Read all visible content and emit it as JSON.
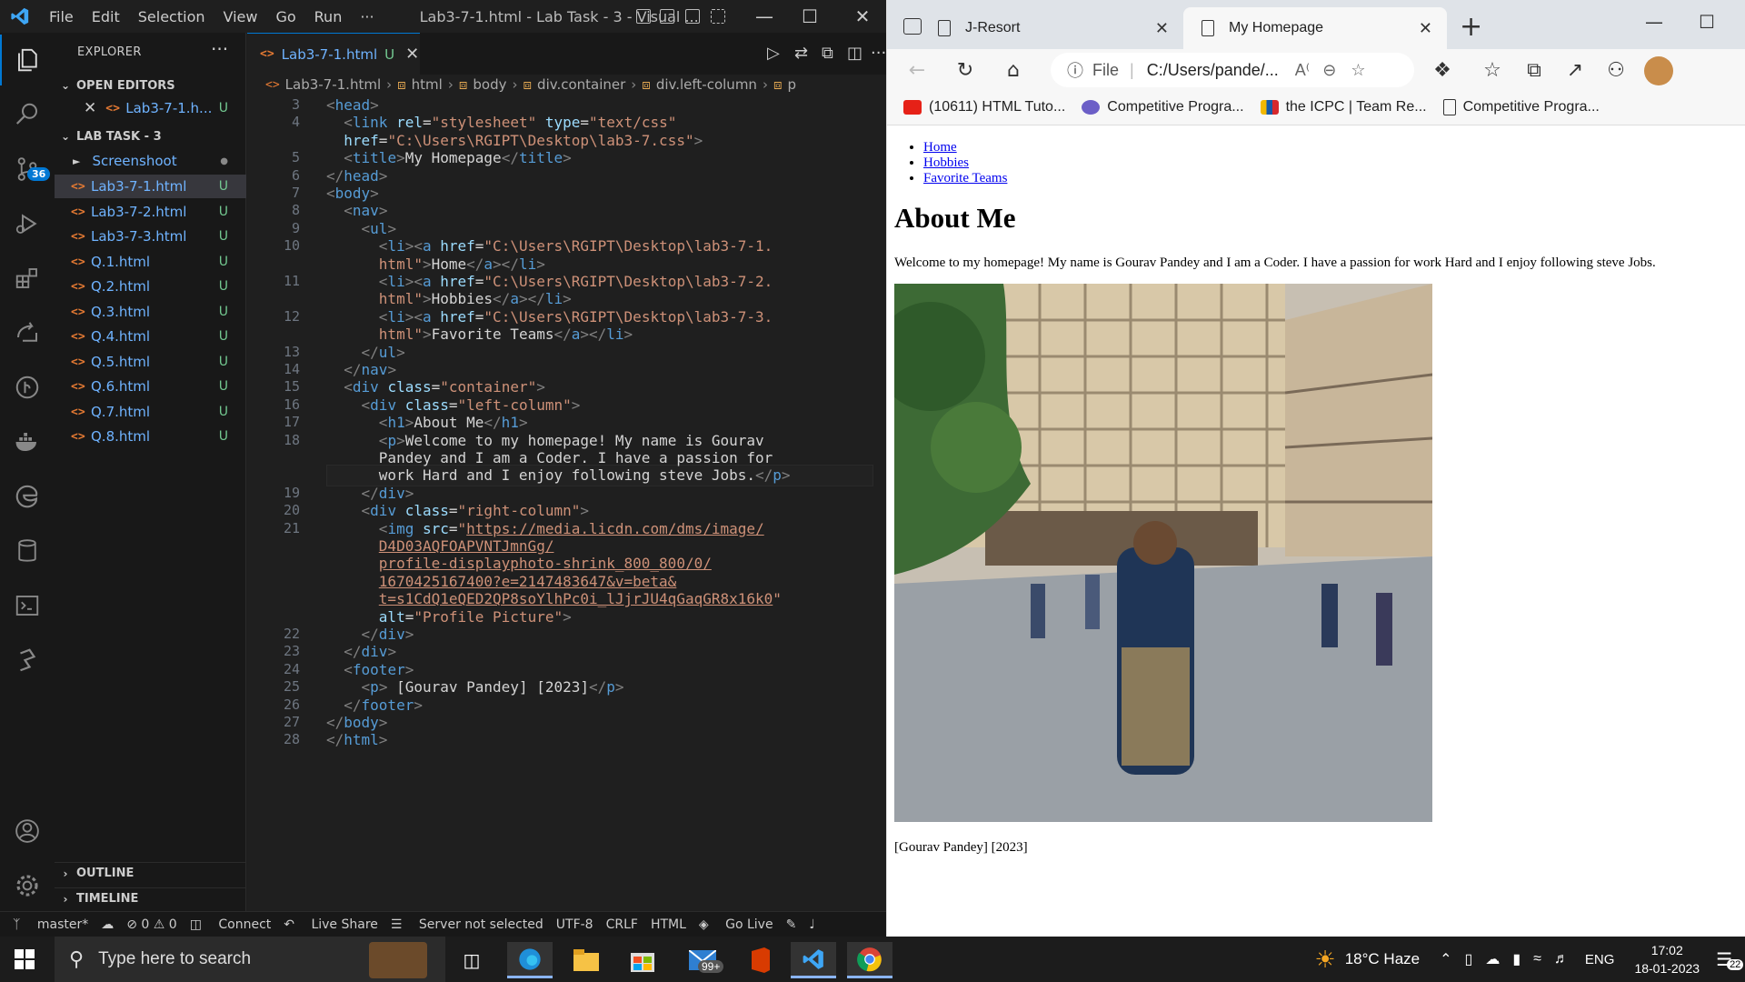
{
  "vscode": {
    "menu": [
      "File",
      "Edit",
      "Selection",
      "View",
      "Go",
      "Run",
      "···"
    ],
    "window_title": "Lab3-7-1.html - Lab Task - 3 - Visual ...",
    "sidebar": {
      "header": "EXPLORER",
      "open_editors_label": "OPEN EDITORS",
      "open_editor_file": "Lab3-7-1.h...",
      "open_editor_status": "U",
      "folder_label": "LAB TASK - 3",
      "folder_items": [
        {
          "name": "Screenshoot",
          "status": "●"
        },
        {
          "name": "Lab3-7-1.html",
          "status": "U"
        },
        {
          "name": "Lab3-7-2.html",
          "status": "U"
        },
        {
          "name": "Lab3-7-3.html",
          "status": "U"
        },
        {
          "name": "Q.1.html",
          "status": "U"
        },
        {
          "name": "Q.2.html",
          "status": "U"
        },
        {
          "name": "Q.3.html",
          "status": "U"
        },
        {
          "name": "Q.4.html",
          "status": "U"
        },
        {
          "name": "Q.5.html",
          "status": "U"
        },
        {
          "name": "Q.6.html",
          "status": "U"
        },
        {
          "name": "Q.7.html",
          "status": "U"
        },
        {
          "name": "Q.8.html",
          "status": "U"
        }
      ],
      "outline_label": "OUTLINE",
      "timeline_label": "TIMELINE",
      "scm_badge": "36"
    },
    "tab": {
      "label": "Lab3-7-1.html",
      "status": "U"
    },
    "breadcrumb": [
      "Lab3-7-1.html",
      "html",
      "body",
      "div.container",
      "div.left-column",
      "p"
    ],
    "line_numbers": [
      "3",
      "4",
      "",
      "5",
      "6",
      "7",
      "8",
      "9",
      "10",
      "",
      "11",
      "",
      "12",
      "",
      "13",
      "14",
      "15",
      "16",
      "17",
      "18",
      "",
      "",
      "19",
      "20",
      "21",
      "",
      "",
      "",
      "",
      "",
      "22",
      "23",
      "24",
      "25",
      "26",
      "27",
      "28"
    ],
    "statusbar": [
      "master*",
      "⊘ 0 ⚠ 0",
      "Connect",
      "Live Share",
      "Server not selected",
      "UTF-8",
      "CRLF",
      "HTML",
      "Go Live"
    ]
  },
  "browser": {
    "tabs": [
      {
        "label": "J-Resort"
      },
      {
        "label": "My Homepage"
      }
    ],
    "address_scheme": "File",
    "address": "C:/Users/pande/...",
    "bookmarks": [
      "(10611) HTML Tuto...",
      "Competitive Progra...",
      "the ICPC | Team Re...",
      "Competitive Progra..."
    ],
    "page": {
      "nav": [
        "Home",
        "Hobbies",
        "Favorite Teams"
      ],
      "heading": "About Me",
      "welcome": "Welcome to my homepage! My name is Gourav Pandey and I am a Coder. I have a passion for work Hard and I enjoy following steve Jobs.",
      "footer": "[Gourav Pandey] [2023]"
    }
  },
  "taskbar": {
    "search_placeholder": "Type here to search",
    "mail_badge": "99+",
    "weather": "18°C  Haze",
    "language": "ENG",
    "time": "17:02",
    "date": "18-01-2023",
    "notif_count": "22"
  }
}
